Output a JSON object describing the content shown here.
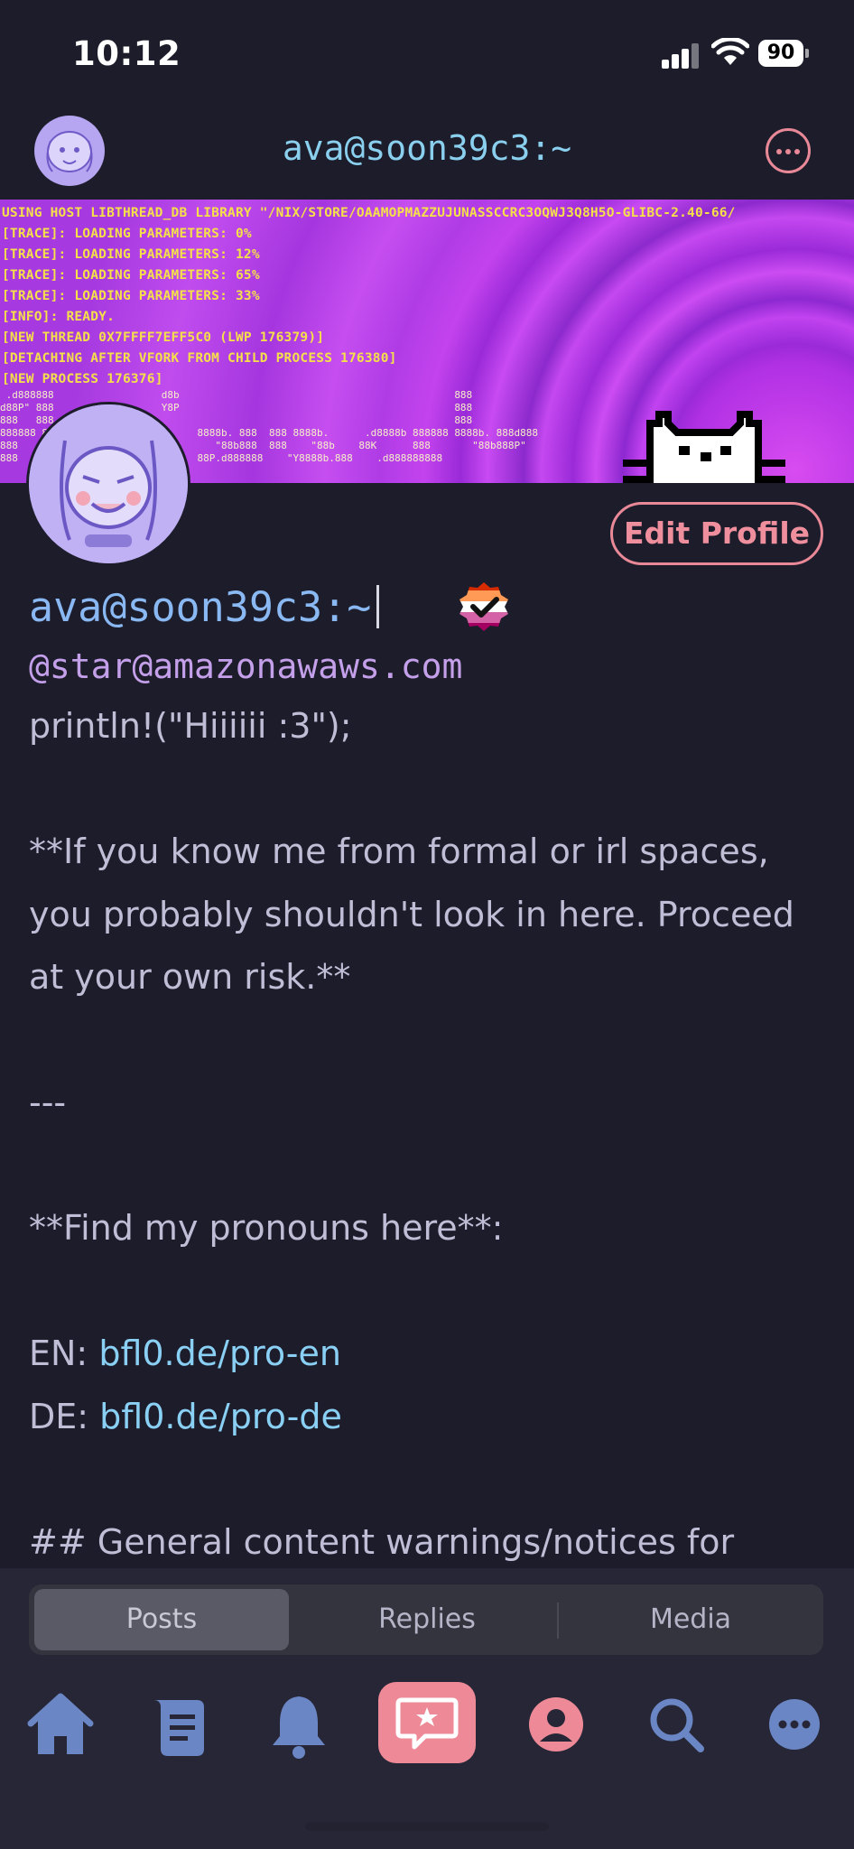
{
  "status_bar": {
    "time": "10:12",
    "battery": "90"
  },
  "header": {
    "title": "ava@soon39c3:~"
  },
  "banner": {
    "log_lines": [
      "USING HOST LIBTHREAD_DB LIBRARY \"/NIX/STORE/OAAMOPMAZZUJUNASSCCRC3OQWJ3Q8H5O-GLIBC-2.40-66/",
      "[TRACE]: LOADING PARAMETERS: 0%",
      "[TRACE]: LOADING PARAMETERS: 12%",
      "[TRACE]: LOADING PARAMETERS: 65%",
      "[TRACE]: LOADING PARAMETERS: 33%",
      "[INFO]: READY.",
      "[NEW THREAD 0X7FFFF7EFF5C0 (LWP 176379)]",
      "[DETACHING AFTER VFORK FROM CHILD PROCESS 176380]",
      "[NEW PROCESS 176376]"
    ]
  },
  "profile": {
    "edit_label": "Edit Profile",
    "display_name": "ava@soon39c3:~",
    "handle": "@star@amazonawaws.com",
    "bio_line1": "println!(\"Hiiiiii :3\");",
    "bio_para1": "**If you know me from formal or irl spaces, you probably shouldn't look in here. Proceed at your own risk.**",
    "bio_rule": "---",
    "bio_pronouns": "**Find my pronouns here**:",
    "en_prefix": "EN: ",
    "en_link": "bfl0.de/pro-en",
    "de_prefix": "DE: ",
    "de_link": "bfl0.de/pro-de",
    "bio_heading": "## General content warnings/notices for"
  },
  "tabs": {
    "posts": "Posts",
    "replies": "Replies",
    "media": "Media"
  },
  "icons": [
    "home-icon",
    "feeds-icon",
    "bell-icon",
    "compose-icon",
    "profile-icon",
    "search-icon",
    "more-icon"
  ],
  "colors": {
    "accent": "#ee8a97",
    "link": "#8ad0f5",
    "name": "#8ab8f2",
    "handle": "#c5a0ea",
    "background": "#1c1c2a"
  }
}
